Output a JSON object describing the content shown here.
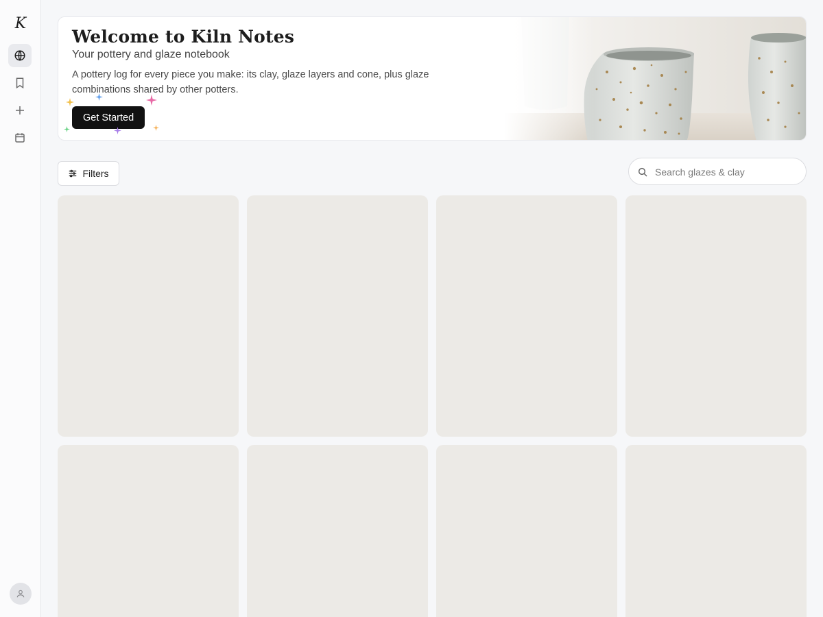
{
  "app": {
    "logo_text": "K"
  },
  "sidebar": {
    "items": [
      {
        "name": "explore",
        "icon": "globe-icon",
        "active": true
      },
      {
        "name": "saved",
        "icon": "bookmark-icon",
        "active": false
      },
      {
        "name": "add",
        "icon": "plus-icon",
        "active": false
      },
      {
        "name": "calendar",
        "icon": "calendar-icon",
        "active": false
      }
    ],
    "avatar_icon": "user-icon"
  },
  "hero": {
    "title": "Welcome to Kiln Notes",
    "subtitle": "Your pottery and glaze notebook",
    "description": "A pottery log for every piece you make: its clay, glaze layers and cone, plus glaze combinations shared by other potters.",
    "cta_label": "Get Started",
    "sparkle_colors": [
      "#f2c14e",
      "#5b9bea",
      "#e86aa6",
      "#5ccf7a",
      "#a77de8",
      "#f4a948"
    ]
  },
  "toolbar": {
    "filters_label": "Filters",
    "search_placeholder": "Search glazes & clay",
    "search_value": ""
  },
  "grid": {
    "card_color": "#eceae6",
    "cards_loading": 8
  }
}
